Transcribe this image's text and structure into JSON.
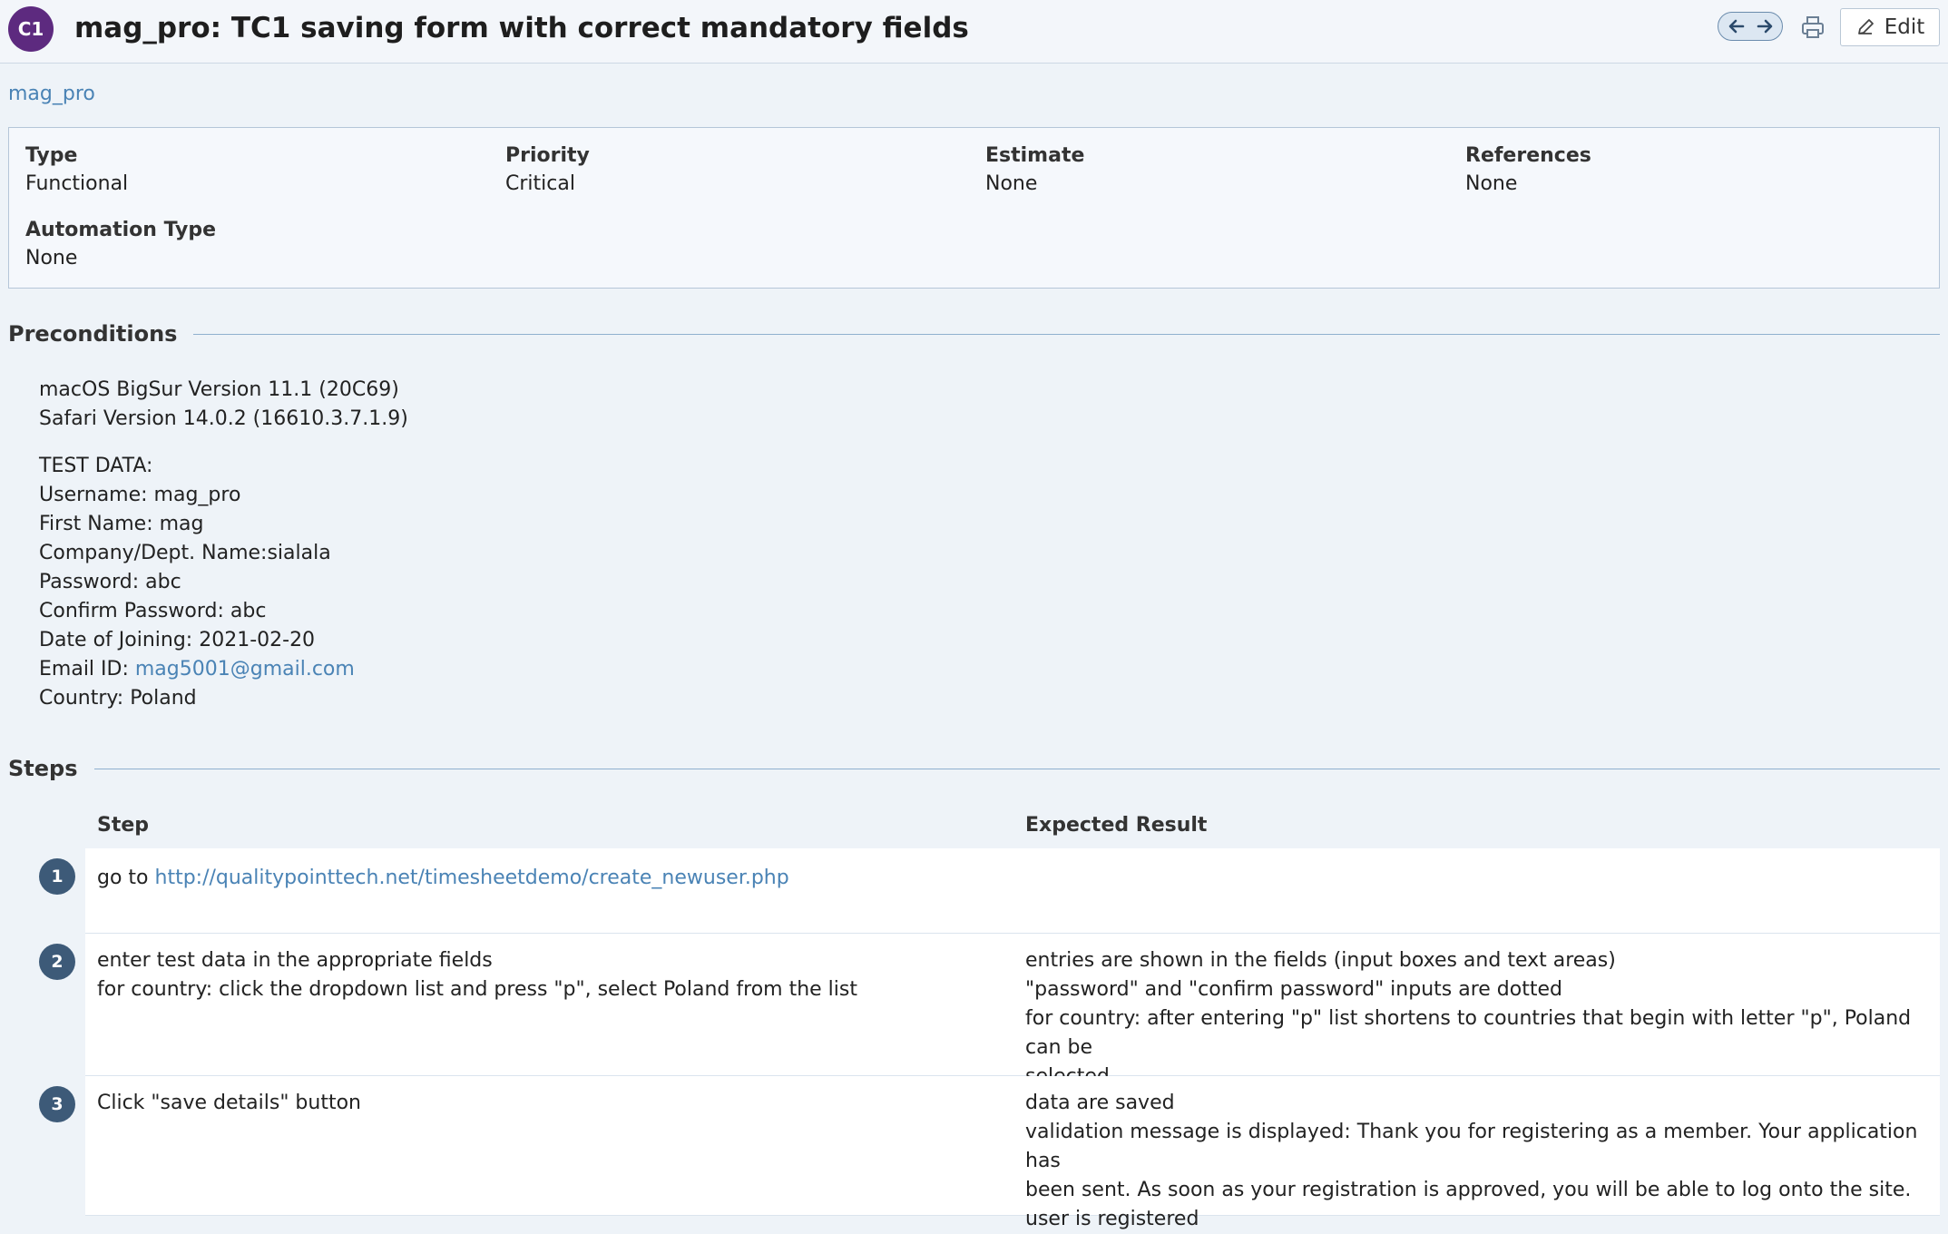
{
  "header": {
    "badge": "C1",
    "title": "mag_pro: TC1 saving form with correct mandatory fields",
    "edit_label": "Edit"
  },
  "breadcrumb": "mag_pro",
  "fields": [
    {
      "label": "Type",
      "value": "Functional"
    },
    {
      "label": "Priority",
      "value": "Critical"
    },
    {
      "label": "Estimate",
      "value": "None"
    },
    {
      "label": "References",
      "value": "None"
    },
    {
      "label": "Automation Type",
      "value": "None"
    }
  ],
  "preconditions": {
    "heading": "Preconditions",
    "env_lines": [
      "macOS BigSur Version 11.1 (20C69)",
      "Safari Version 14.0.2 (16610.3.7.1.9)"
    ],
    "test_data_lines": [
      "TEST DATA:",
      "Username: mag_pro",
      "First Name: mag",
      "Company/Dept. Name:sialala",
      "Password: abc",
      "Confirm Password: abc",
      "Date of Joining: 2021-02-20"
    ],
    "email_label": "Email ID: ",
    "email_link": "mag5001@gmail.com",
    "country_line": "Country: Poland"
  },
  "steps": {
    "heading": "Steps",
    "col_step": "Step",
    "col_expected": "Expected Result",
    "rows": [
      {
        "num": "1",
        "step_prefix": "go to ",
        "step_link": "http://qualitypointtech.net/timesheetdemo/create_newuser.php",
        "step_lines": [],
        "expected_lines": []
      },
      {
        "num": "2",
        "step_prefix": "",
        "step_link": "",
        "step_lines": [
          "enter test data in the appropriate fields",
          "for country: click the dropdown list and press \"p\", select Poland from the list"
        ],
        "expected_lines": [
          "entries are shown in the fields (input boxes and text areas)",
          "\"password\" and \"confirm password\" inputs are dotted",
          "for country: after entering \"p\" list shortens to countries that begin with letter \"p\", Poland can be",
          "selected"
        ]
      },
      {
        "num": "3",
        "step_prefix": "",
        "step_link": "",
        "step_lines": [
          "Click \"save details\" button"
        ],
        "expected_lines": [
          "data are saved",
          "validation message is displayed: Thank you for registering as a member. Your application has",
          "been sent. As soon as your registration is approved, you will be able to log onto the site.",
          "user is registered"
        ]
      }
    ]
  }
}
